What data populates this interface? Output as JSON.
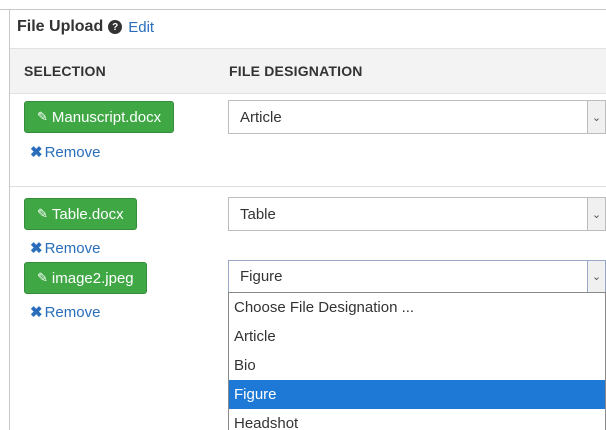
{
  "header": {
    "title": "File Upload",
    "help_icon": "?",
    "edit_label": "Edit"
  },
  "columns": {
    "selection": "SELECTION",
    "designation": "FILE DESIGNATION"
  },
  "files": [
    {
      "name": "Manuscript.docx",
      "designation": "Article",
      "remove_label": "Remove"
    },
    {
      "name": "Table.docx",
      "designation": "Table",
      "remove_label": "Remove"
    },
    {
      "name": "image2.jpeg",
      "designation": "Figure",
      "remove_label": "Remove"
    }
  ],
  "dropdown": {
    "open_for": "image2.jpeg",
    "options": [
      "Choose File Designation ...",
      "Article",
      "Bio",
      "Figure",
      "Headshot"
    ],
    "highlighted": "Figure"
  },
  "colors": {
    "button_green": "#3fa845",
    "link_blue": "#2a6ebb",
    "highlight_blue": "#1e78d6",
    "header_bg": "#f3f3f3"
  },
  "icons": {
    "attach": "paperclip-icon",
    "remove": "remove-x-icon",
    "caret": "chevron-down-icon",
    "help": "question-circle-icon"
  }
}
